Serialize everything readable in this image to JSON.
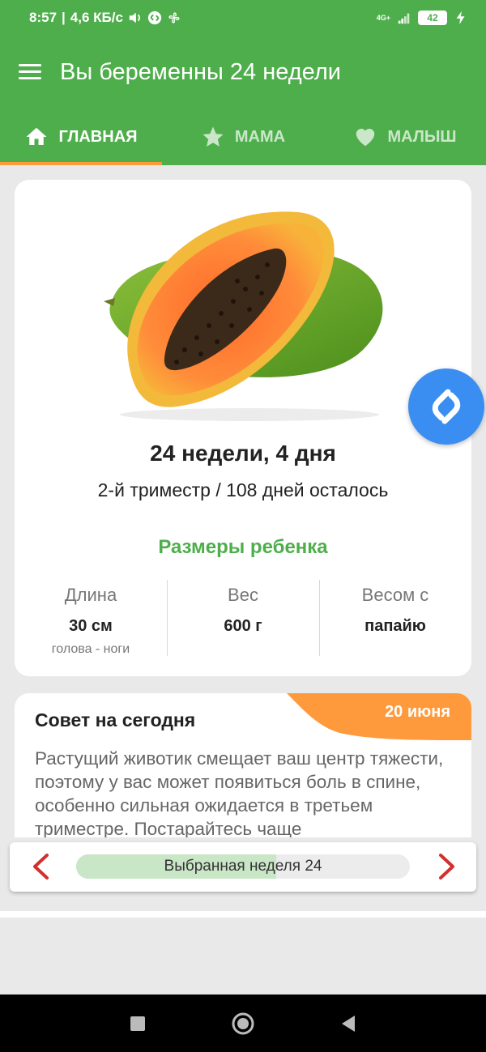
{
  "status_bar": {
    "time": "8:57",
    "speed": "4,6 КБ/с",
    "network": "4G+",
    "battery": "42"
  },
  "app_bar": {
    "title": "Вы беременны 24 недели"
  },
  "tabs": [
    {
      "label": "ГЛАВНАЯ",
      "icon": "home-icon",
      "active": true
    },
    {
      "label": "МАМА",
      "icon": "star-icon",
      "active": false
    },
    {
      "label": "МАЛЫШ",
      "icon": "heart-icon",
      "active": false
    }
  ],
  "main_card": {
    "image": "papaya",
    "week_title": "24 недели, 4 дня",
    "trimester": "2-й триместр / 108 дней осталось",
    "sizes_title": "Размеры ребенка",
    "stats": [
      {
        "label": "Длина",
        "value": "30 см",
        "sub": "голова - ноги"
      },
      {
        "label": "Вес",
        "value": "600 г",
        "sub": ""
      },
      {
        "label": "Весом с",
        "value": "папайю",
        "sub": ""
      }
    ]
  },
  "tip_card": {
    "title": "Совет на сегодня",
    "date": "20 июня",
    "text": "Растущий животик смещает ваш центр тяжести, поэтому у вас может появиться боль в спине, особенно сильная ожидается в третьем триместре. Постарайтесь чаще"
  },
  "week_selector": {
    "label": "Выбранная неделя 24",
    "progress": 0.6
  },
  "colors": {
    "primary": "#4fae4c",
    "accent": "#ff9a3c",
    "arrow": "#d32f2f",
    "shazam": "#3a8ef2"
  }
}
